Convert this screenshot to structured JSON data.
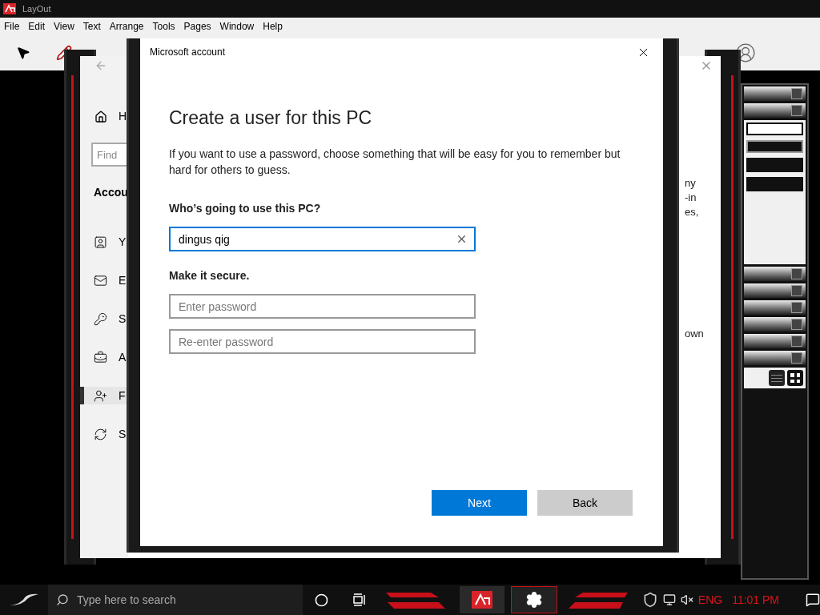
{
  "app": {
    "title": "LayOut",
    "menu": [
      "File",
      "Edit",
      "View",
      "Text",
      "Arrange",
      "Tools",
      "Pages",
      "Window",
      "Help"
    ]
  },
  "settings_window": {
    "nav": {
      "home": "H",
      "search_placeholder": "Find",
      "section": "Accou",
      "items": [
        {
          "label": "Y",
          "kind": "person-card",
          "selected": false
        },
        {
          "label": "E",
          "kind": "mail",
          "selected": false
        },
        {
          "label": "S",
          "kind": "key",
          "selected": false
        },
        {
          "label": "A",
          "kind": "briefcase",
          "selected": false
        },
        {
          "label": "F",
          "kind": "person-add",
          "selected": true
        },
        {
          "label": "S",
          "kind": "sync",
          "selected": false
        }
      ]
    },
    "body_fragments": [
      "ny",
      "-in",
      "es,",
      "own"
    ]
  },
  "dialog": {
    "title": "Microsoft account",
    "heading": "Create a user for this PC",
    "intro": "If you want to use a password, choose something that will be easy for you to remember but hard for others to guess.",
    "user_label": "Who’s going to use this PC?",
    "user_value": "dingus qig",
    "secure_label": "Make it secure.",
    "password_placeholder": "Enter password",
    "reenter_placeholder": "Re-enter password",
    "buttons": [
      {
        "label": "Next",
        "kind": "primary"
      },
      {
        "label": "Back",
        "kind": "secondary"
      }
    ]
  },
  "taskbar": {
    "search_placeholder": "Type here to search",
    "language": "ENG",
    "time": "11:01 PM"
  }
}
